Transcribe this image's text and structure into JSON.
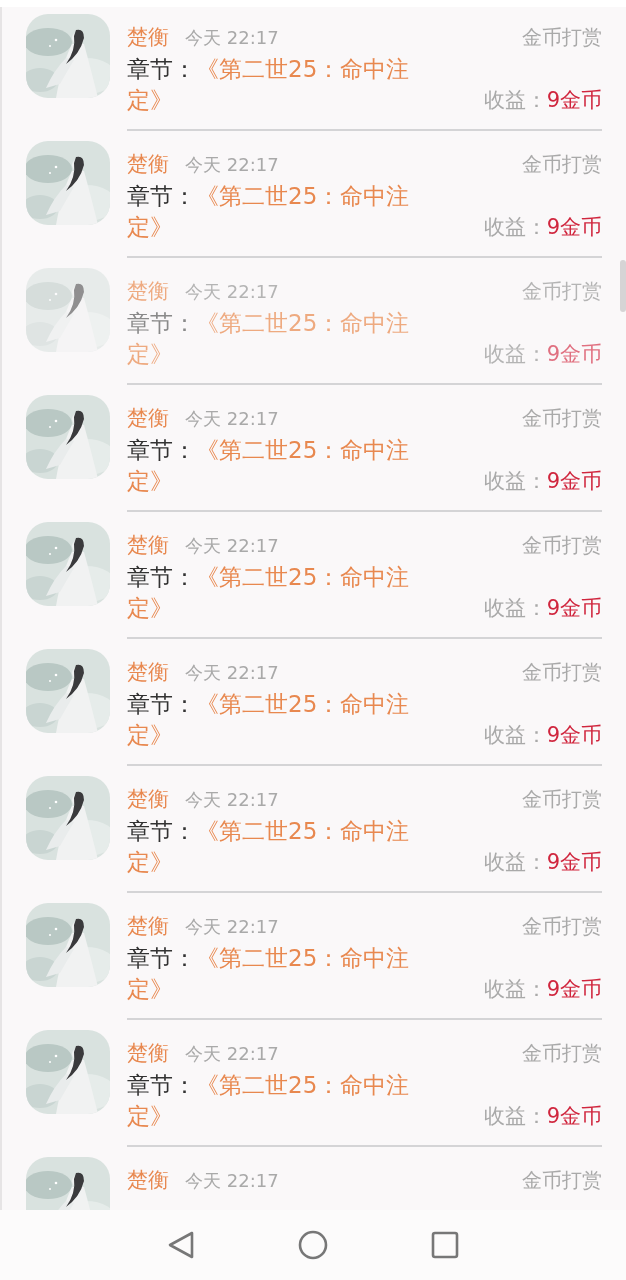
{
  "rows": [
    {
      "name": "楚衡",
      "time": "今天 22:17",
      "reward_type": "金币打赏",
      "chapter_label": "章节：",
      "chapter_title": "《第二世25：命中注定》",
      "income_label": "收益：",
      "income_value": "9金币",
      "faded": false
    },
    {
      "name": "楚衡",
      "time": "今天 22:17",
      "reward_type": "金币打赏",
      "chapter_label": "章节：",
      "chapter_title": "《第二世25：命中注定》",
      "income_label": "收益：",
      "income_value": "9金币",
      "faded": false
    },
    {
      "name": "楚衡",
      "time": "今天 22:17",
      "reward_type": "金币打赏",
      "chapter_label": "章节：",
      "chapter_title": "《第二世25：命中注定》",
      "income_label": "收益：",
      "income_value": "9金币",
      "faded": true
    },
    {
      "name": "楚衡",
      "time": "今天 22:17",
      "reward_type": "金币打赏",
      "chapter_label": "章节：",
      "chapter_title": "《第二世25：命中注定》",
      "income_label": "收益：",
      "income_value": "9金币",
      "faded": false
    },
    {
      "name": "楚衡",
      "time": "今天 22:17",
      "reward_type": "金币打赏",
      "chapter_label": "章节：",
      "chapter_title": "《第二世25：命中注定》",
      "income_label": "收益：",
      "income_value": "9金币",
      "faded": false
    },
    {
      "name": "楚衡",
      "time": "今天 22:17",
      "reward_type": "金币打赏",
      "chapter_label": "章节：",
      "chapter_title": "《第二世25：命中注定》",
      "income_label": "收益：",
      "income_value": "9金币",
      "faded": false
    },
    {
      "name": "楚衡",
      "time": "今天 22:17",
      "reward_type": "金币打赏",
      "chapter_label": "章节：",
      "chapter_title": "《第二世25：命中注定》",
      "income_label": "收益：",
      "income_value": "9金币",
      "faded": false
    },
    {
      "name": "楚衡",
      "time": "今天 22:17",
      "reward_type": "金币打赏",
      "chapter_label": "章节：",
      "chapter_title": "《第二世25：命中注定》",
      "income_label": "收益：",
      "income_value": "9金币",
      "faded": false
    },
    {
      "name": "楚衡",
      "time": "今天 22:17",
      "reward_type": "金币打赏",
      "chapter_label": "章节：",
      "chapter_title": "《第二世25：命中注定》",
      "income_label": "收益：",
      "income_value": "9金币",
      "faded": false
    },
    {
      "name": "楚衡",
      "time": "今天 22:17",
      "reward_type": "金币打赏",
      "faded": false
    }
  ]
}
